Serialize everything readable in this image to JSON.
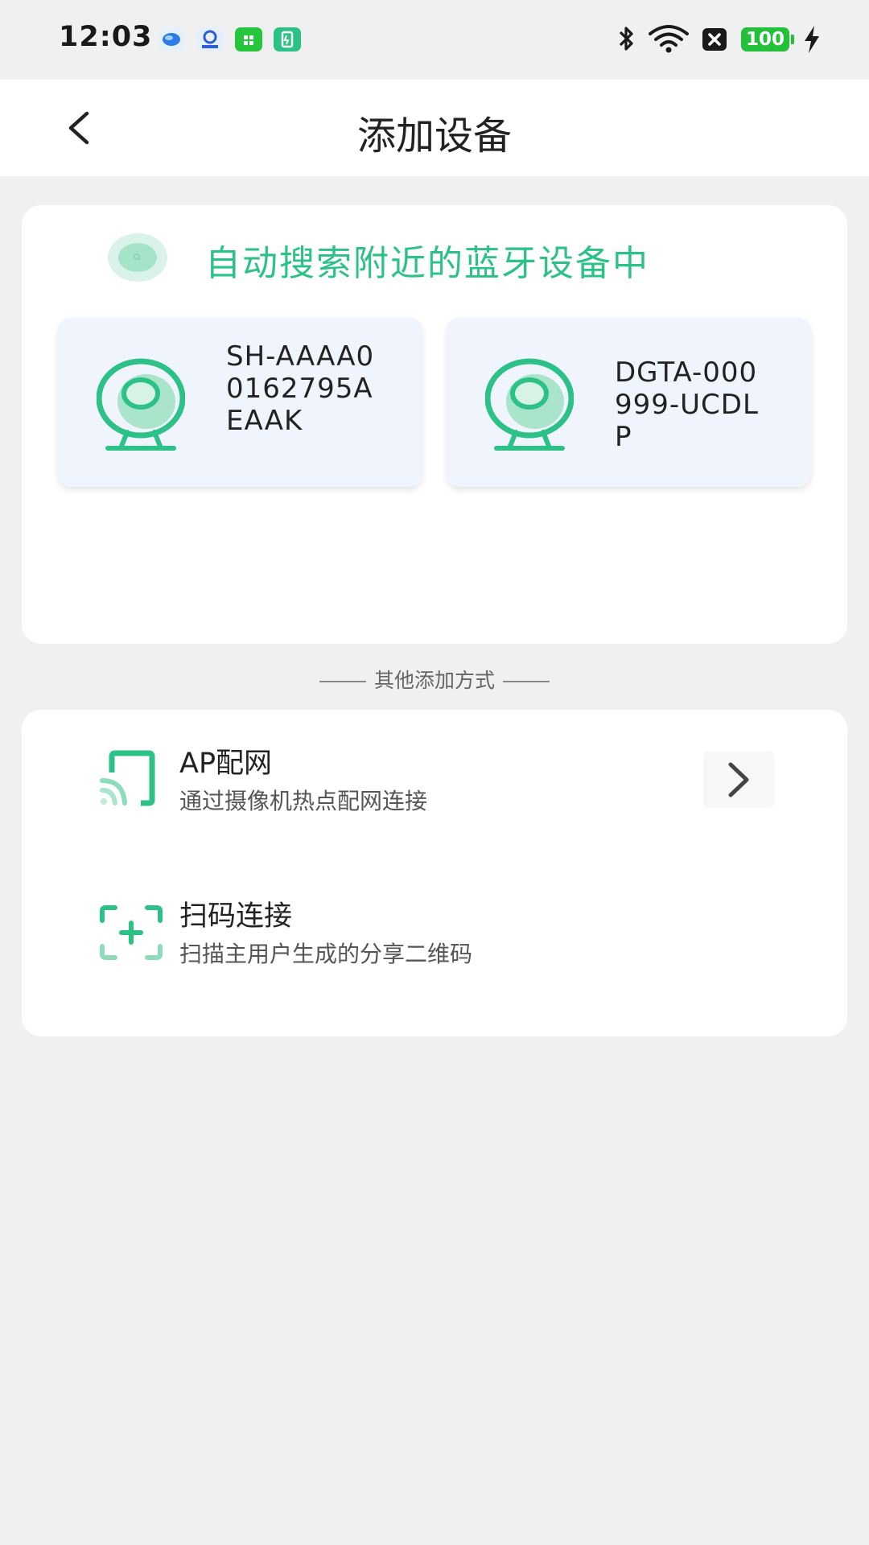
{
  "status_bar": {
    "time": "12:03",
    "battery_level": "100",
    "icons": [
      "bluetooth-icon",
      "wifi-icon",
      "close-box-icon",
      "battery-icon",
      "charging-icon"
    ]
  },
  "header": {
    "title": "添加设备",
    "back_icon": "chevron-left-icon"
  },
  "search": {
    "status_text": "自动搜索附近的蓝牙设备中",
    "devices": [
      {
        "name": "SH-AAAA00162795AEAAK",
        "icon": "camera-icon"
      },
      {
        "name": "DGTA-000999-UCDLP",
        "icon": "camera-icon"
      }
    ]
  },
  "other_methods_label": "其他添加方式",
  "methods": [
    {
      "title": "AP配网",
      "subtitle": "通过摄像机热点配网连接",
      "icon": "ap-cast-icon"
    },
    {
      "title": "扫码连接",
      "subtitle": "扫描主用户生成的分享二维码",
      "icon": "qr-scan-icon"
    }
  ],
  "colors": {
    "accent": "#2cc287",
    "background": "#f0f0f1",
    "device_card": "#eff4fd"
  }
}
